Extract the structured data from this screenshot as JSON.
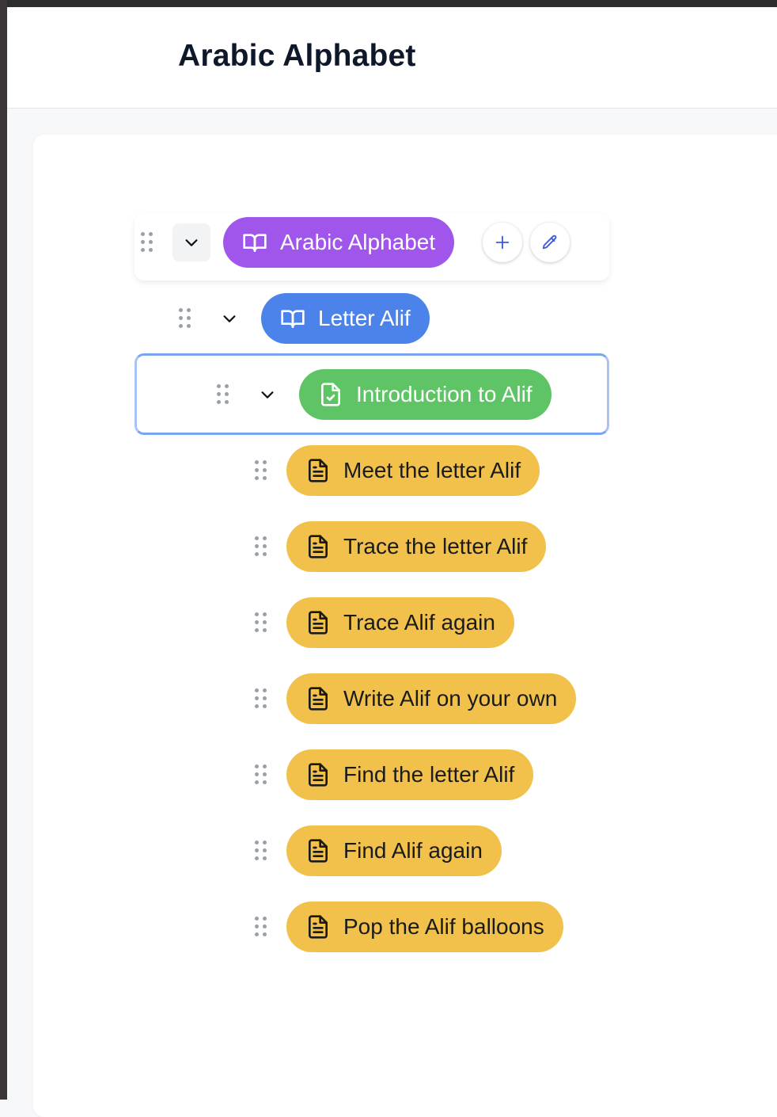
{
  "header": {
    "title": "Arabic Alphabet"
  },
  "colors": {
    "course": "#a056ea",
    "unit": "#4c83ea",
    "lesson": "#5ec466",
    "activity": "#f1c14c",
    "accent": "#3b5bdb"
  },
  "tree": {
    "root": {
      "label": "Arabic Alphabet",
      "icon": "book-open-icon",
      "actions": {
        "add_icon": "plus-icon",
        "edit_icon": "pencil-icon"
      }
    },
    "unit": {
      "label": "Letter Alif",
      "icon": "book-open-icon"
    },
    "lesson": {
      "label": "Introduction to Alif",
      "icon": "file-check-icon"
    },
    "activities": [
      {
        "label": "Meet the letter Alif",
        "icon": "file-text-icon"
      },
      {
        "label": "Trace the letter Alif",
        "icon": "file-text-icon"
      },
      {
        "label": "Trace Alif again",
        "icon": "file-text-icon"
      },
      {
        "label": "Write Alif on your own",
        "icon": "file-text-icon"
      },
      {
        "label": "Find the letter Alif",
        "icon": "file-text-icon"
      },
      {
        "label": "Find Alif again",
        "icon": "file-text-icon"
      },
      {
        "label": "Pop the Alif balloons",
        "icon": "file-text-icon"
      }
    ]
  }
}
